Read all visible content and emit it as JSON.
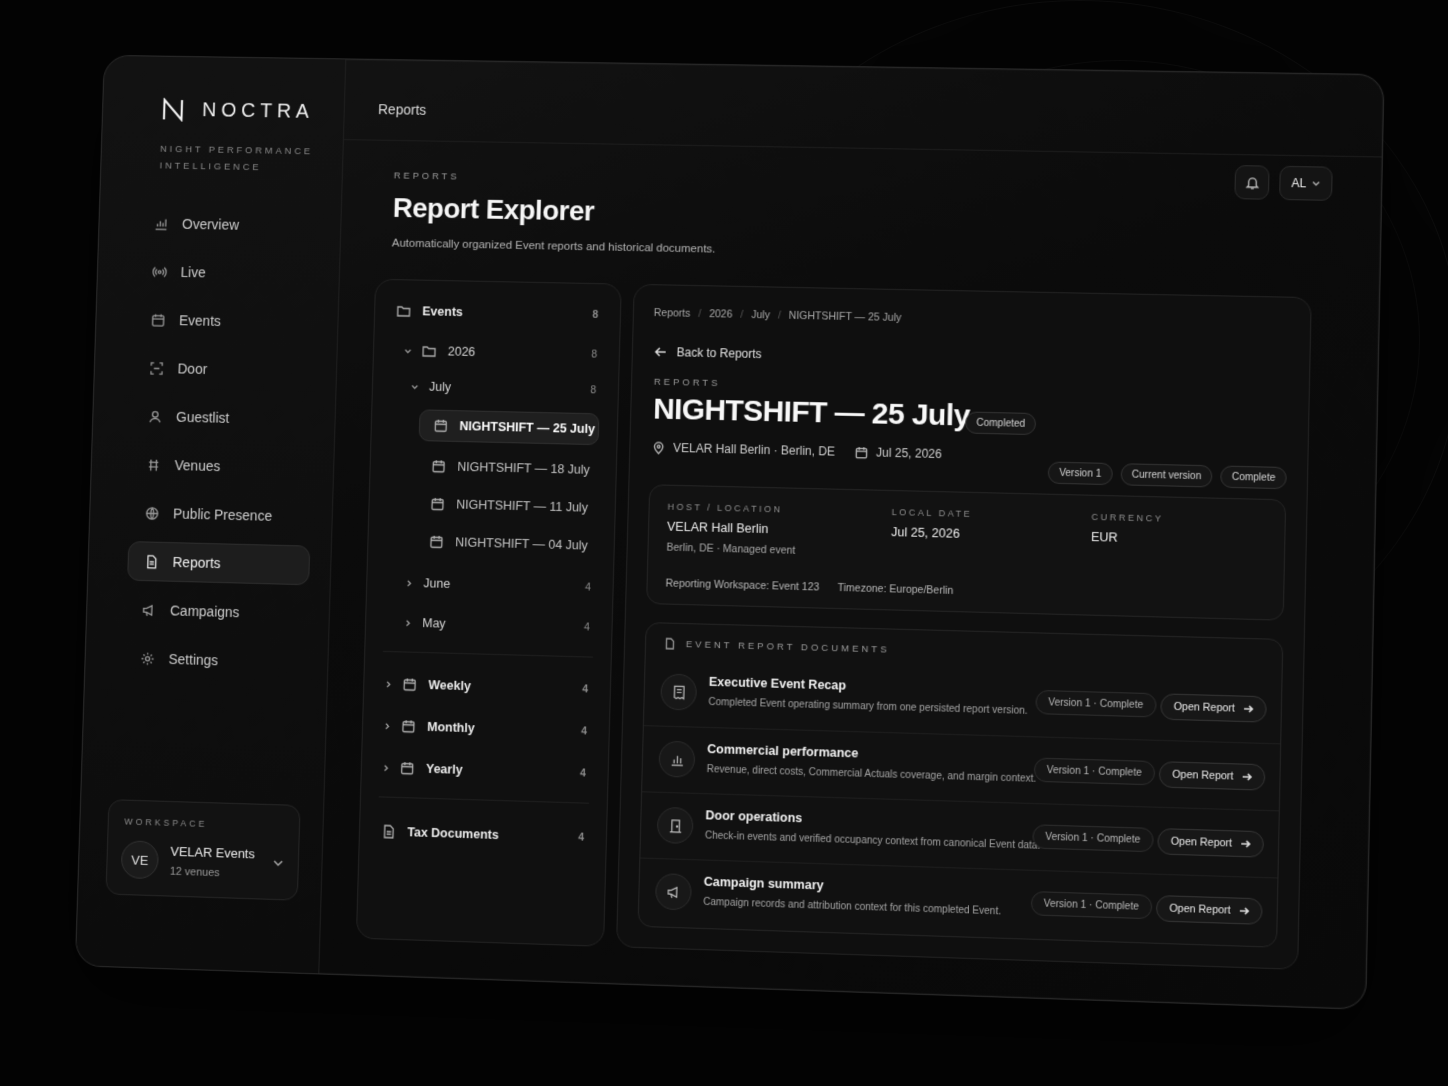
{
  "brand": {
    "name": "NOCTRA",
    "tagline": "Night Performance Intelligence"
  },
  "sidebar": {
    "items": [
      {
        "label": "Overview",
        "icon": "chart-icon"
      },
      {
        "label": "Live",
        "icon": "broadcast-icon"
      },
      {
        "label": "Events",
        "icon": "calendar-icon"
      },
      {
        "label": "Door",
        "icon": "scan-icon"
      },
      {
        "label": "Guestlist",
        "icon": "user-icon"
      },
      {
        "label": "Venues",
        "icon": "venue-icon"
      },
      {
        "label": "Public Presence",
        "icon": "globe-icon"
      },
      {
        "label": "Reports",
        "icon": "document-icon",
        "active": true
      },
      {
        "label": "Campaigns",
        "icon": "megaphone-icon"
      },
      {
        "label": "Settings",
        "icon": "gear-icon"
      }
    ]
  },
  "workspace": {
    "label": "Workspace",
    "initials": "VE",
    "name": "VELAR Events",
    "sub": "12 venues"
  },
  "topbar": {
    "title": "Reports",
    "user_initials": "AL"
  },
  "page": {
    "overline": "Reports",
    "title": "Report Explorer",
    "subtitle": "Automatically organized Event reports and historical documents."
  },
  "tree": {
    "events": {
      "label": "Events",
      "count": "8"
    },
    "year": {
      "label": "2026",
      "count": "8"
    },
    "month": {
      "label": "July",
      "count": "8"
    },
    "july_items": [
      "NIGHTSHIFT — 25 July",
      "NIGHTSHIFT — 18 July",
      "NIGHTSHIFT — 11 July",
      "NIGHTSHIFT — 04 July"
    ],
    "june": {
      "label": "June",
      "count": "4"
    },
    "may": {
      "label": "May",
      "count": "4"
    },
    "weekly": {
      "label": "Weekly",
      "count": "4"
    },
    "monthly": {
      "label": "Monthly",
      "count": "4"
    },
    "yearly": {
      "label": "Yearly",
      "count": "4"
    },
    "tax": {
      "label": "Tax Documents",
      "count": "4"
    }
  },
  "detail": {
    "breadcrumbs": [
      "Reports",
      "2026",
      "July",
      "NIGHTSHIFT — 25 July"
    ],
    "back_label": "Back to Reports",
    "overline": "Reports",
    "title": "NIGHTSHIFT — 25 July",
    "status": "Completed",
    "venue": "VELAR Hall Berlin · Berlin, DE",
    "date": "Jul 25, 2026",
    "pills": [
      "Version 1",
      "Current version",
      "Complete"
    ],
    "info": {
      "host_label": "Host / Location",
      "host_value": "VELAR Hall Berlin",
      "host_sub": "Berlin, DE  ·  Managed event",
      "date_label": "Local Date",
      "date_value": "Jul 25, 2026",
      "currency_label": "Currency",
      "currency_value": "EUR",
      "workspace": "Reporting Workspace: Event 123",
      "timezone": "Timezone: Europe/Berlin"
    },
    "docs_heading": "Event Report Documents",
    "documents": [
      {
        "title": "Executive Event Recap",
        "desc": "Completed Event operating summary from one persisted report version.",
        "version": "Version 1 · Complete",
        "action": "Open Report",
        "icon": "receipt-icon"
      },
      {
        "title": "Commercial performance",
        "desc": "Revenue, direct costs, Commercial Actuals coverage, and margin context.",
        "version": "Version 1 · Complete",
        "action": "Open Report",
        "icon": "bar-chart-icon"
      },
      {
        "title": "Door operations",
        "desc": "Check-in events and verified occupancy context from canonical Event data.",
        "version": "Version 1 · Complete",
        "action": "Open Report",
        "icon": "door-icon"
      },
      {
        "title": "Campaign summary",
        "desc": "Campaign records and attribution context for this completed Event.",
        "version": "Version 1 · Complete",
        "action": "Open Report",
        "icon": "megaphone-icon"
      }
    ]
  }
}
